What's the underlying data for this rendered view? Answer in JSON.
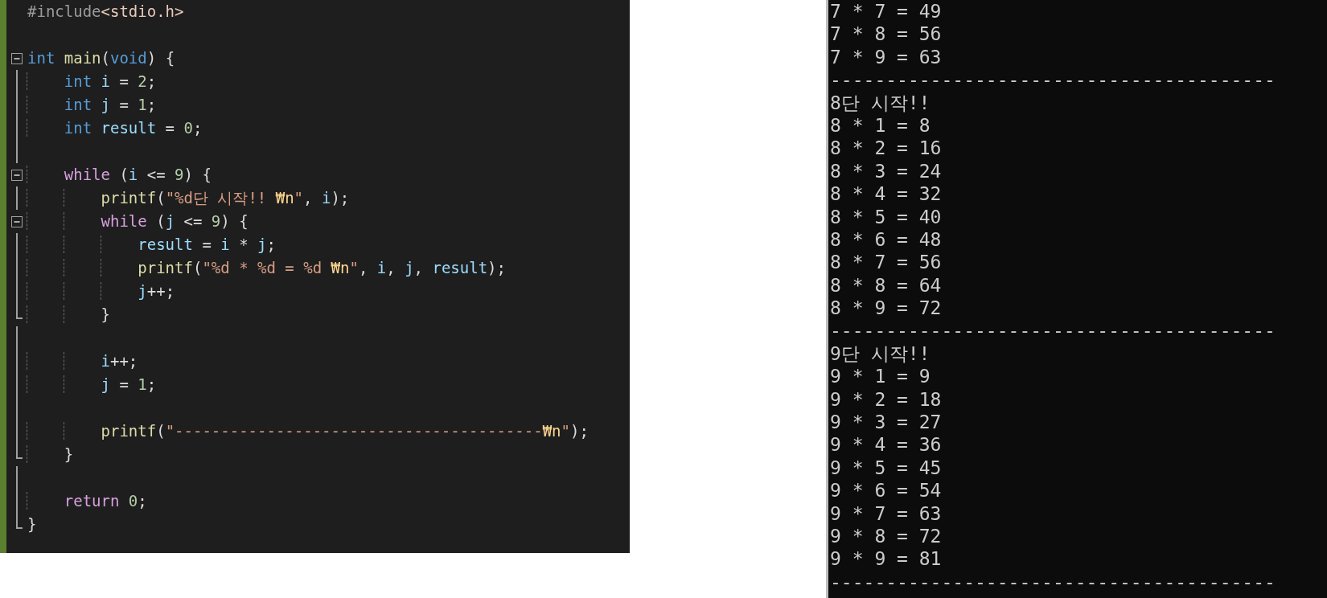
{
  "editor": {
    "lines": [
      {
        "kind": "plain",
        "tokens": [
          {
            "text": "#include",
            "kind": "preproc"
          },
          {
            "text": "<stdio.h>",
            "kind": "header"
          }
        ]
      },
      {
        "kind": "plain"
      },
      {
        "kind": "block-start",
        "tokens": [
          {
            "text": "int",
            "kind": "keyword"
          },
          {
            "text": " main",
            "kind": "func"
          },
          {
            "text": "(",
            "kind": "punct"
          },
          {
            "text": "void",
            "kind": "keyword"
          },
          {
            "text": ") {",
            "kind": "punct"
          }
        ]
      },
      {
        "kind": "block-body",
        "tokens": [
          {
            "text": "    int",
            "kind": "keyword"
          },
          {
            "text": " i",
            "kind": "ident"
          },
          {
            "text": " = ",
            "kind": "punct"
          },
          {
            "text": "2",
            "kind": "number"
          },
          {
            "text": ";",
            "kind": "punct"
          }
        ]
      },
      {
        "kind": "block-body",
        "tokens": [
          {
            "text": "    int",
            "kind": "keyword"
          },
          {
            "text": " j",
            "kind": "ident"
          },
          {
            "text": " = ",
            "kind": "punct"
          },
          {
            "text": "1",
            "kind": "number"
          },
          {
            "text": ";",
            "kind": "punct"
          }
        ]
      },
      {
        "kind": "block-body",
        "tokens": [
          {
            "text": "    int",
            "kind": "keyword"
          },
          {
            "text": " result",
            "kind": "ident"
          },
          {
            "text": " = ",
            "kind": "punct"
          },
          {
            "text": "0",
            "kind": "number"
          },
          {
            "text": ";",
            "kind": "punct"
          }
        ]
      },
      {
        "kind": "block-body"
      },
      {
        "kind": "block-start",
        "tokens": [
          {
            "text": "    while",
            "kind": "control"
          },
          {
            "text": " (",
            "kind": "punct"
          },
          {
            "text": "i",
            "kind": "ident"
          },
          {
            "text": " <= ",
            "kind": "punct"
          },
          {
            "text": "9",
            "kind": "number"
          },
          {
            "text": ") {",
            "kind": "punct"
          }
        ]
      },
      {
        "kind": "block-body",
        "tokens": [
          {
            "text": "        printf",
            "kind": "func"
          },
          {
            "text": "(",
            "kind": "punct"
          },
          {
            "text": "\"%d단 시작!! ",
            "kind": "string"
          },
          {
            "text": "₩n",
            "kind": "escape"
          },
          {
            "text": "\"",
            "kind": "string"
          },
          {
            "text": ", ",
            "kind": "punct"
          },
          {
            "text": "i",
            "kind": "ident"
          },
          {
            "text": ");",
            "kind": "punct"
          }
        ]
      },
      {
        "kind": "block-start",
        "tokens": [
          {
            "text": "        while",
            "kind": "control"
          },
          {
            "text": " (",
            "kind": "punct"
          },
          {
            "text": "j",
            "kind": "ident"
          },
          {
            "text": " <= ",
            "kind": "punct"
          },
          {
            "text": "9",
            "kind": "number"
          },
          {
            "text": ") {",
            "kind": "punct"
          }
        ]
      },
      {
        "kind": "block-body",
        "tokens": [
          {
            "text": "            result",
            "kind": "ident"
          },
          {
            "text": " = ",
            "kind": "punct"
          },
          {
            "text": "i",
            "kind": "ident"
          },
          {
            "text": " * ",
            "kind": "punct"
          },
          {
            "text": "j",
            "kind": "ident"
          },
          {
            "text": ";",
            "kind": "punct"
          }
        ]
      },
      {
        "kind": "block-body",
        "tokens": [
          {
            "text": "            printf",
            "kind": "func"
          },
          {
            "text": "(",
            "kind": "punct"
          },
          {
            "text": "\"%d * %d = %d ",
            "kind": "string"
          },
          {
            "text": "₩n",
            "kind": "escape"
          },
          {
            "text": "\"",
            "kind": "string"
          },
          {
            "text": ", ",
            "kind": "punct"
          },
          {
            "text": "i",
            "kind": "ident"
          },
          {
            "text": ", ",
            "kind": "punct"
          },
          {
            "text": "j",
            "kind": "ident"
          },
          {
            "text": ", ",
            "kind": "punct"
          },
          {
            "text": "result",
            "kind": "ident"
          },
          {
            "text": ");",
            "kind": "punct"
          }
        ]
      },
      {
        "kind": "block-body",
        "tokens": [
          {
            "text": "            j",
            "kind": "ident"
          },
          {
            "text": "++;",
            "kind": "punct"
          }
        ]
      },
      {
        "kind": "block-end",
        "tokens": [
          {
            "text": "        }",
            "kind": "punct"
          }
        ]
      },
      {
        "kind": "block-body"
      },
      {
        "kind": "block-body",
        "tokens": [
          {
            "text": "        i",
            "kind": "ident"
          },
          {
            "text": "++;",
            "kind": "punct"
          }
        ]
      },
      {
        "kind": "block-body",
        "tokens": [
          {
            "text": "        j",
            "kind": "ident"
          },
          {
            "text": " = ",
            "kind": "punct"
          },
          {
            "text": "1",
            "kind": "number"
          },
          {
            "text": ";",
            "kind": "punct"
          }
        ]
      },
      {
        "kind": "block-body"
      },
      {
        "kind": "block-body",
        "tokens": [
          {
            "text": "        printf",
            "kind": "func"
          },
          {
            "text": "(",
            "kind": "punct"
          },
          {
            "text": "\"----------------------------------------",
            "kind": "string"
          },
          {
            "text": "₩n",
            "kind": "escape"
          },
          {
            "text": "\"",
            "kind": "string"
          },
          {
            "text": ");",
            "kind": "punct"
          }
        ]
      },
      {
        "kind": "block-end",
        "tokens": [
          {
            "text": "    }",
            "kind": "punct"
          }
        ]
      },
      {
        "kind": "block-body"
      },
      {
        "kind": "block-body",
        "tokens": [
          {
            "text": "    return",
            "kind": "control"
          },
          {
            "text": " 0",
            "kind": "number"
          },
          {
            "text": ";",
            "kind": "punct"
          }
        ]
      },
      {
        "kind": "block-end",
        "tokens": [
          {
            "text": "}",
            "kind": "punct"
          }
        ]
      }
    ]
  },
  "console": {
    "lines": [
      "7 * 7 = 49",
      "7 * 8 = 56",
      "7 * 9 = 63",
      "----------------------------------------",
      "8단 시작!!",
      "8 * 1 = 8",
      "8 * 2 = 16",
      "8 * 3 = 24",
      "8 * 4 = 32",
      "8 * 5 = 40",
      "8 * 6 = 48",
      "8 * 7 = 56",
      "8 * 8 = 64",
      "8 * 9 = 72",
      "----------------------------------------",
      "9단 시작!!",
      "9 * 1 = 9",
      "9 * 2 = 18",
      "9 * 3 = 27",
      "9 * 4 = 36",
      "9 * 5 = 45",
      "9 * 6 = 54",
      "9 * 7 = 63",
      "9 * 8 = 72",
      "9 * 9 = 81",
      "----------------------------------------"
    ]
  }
}
